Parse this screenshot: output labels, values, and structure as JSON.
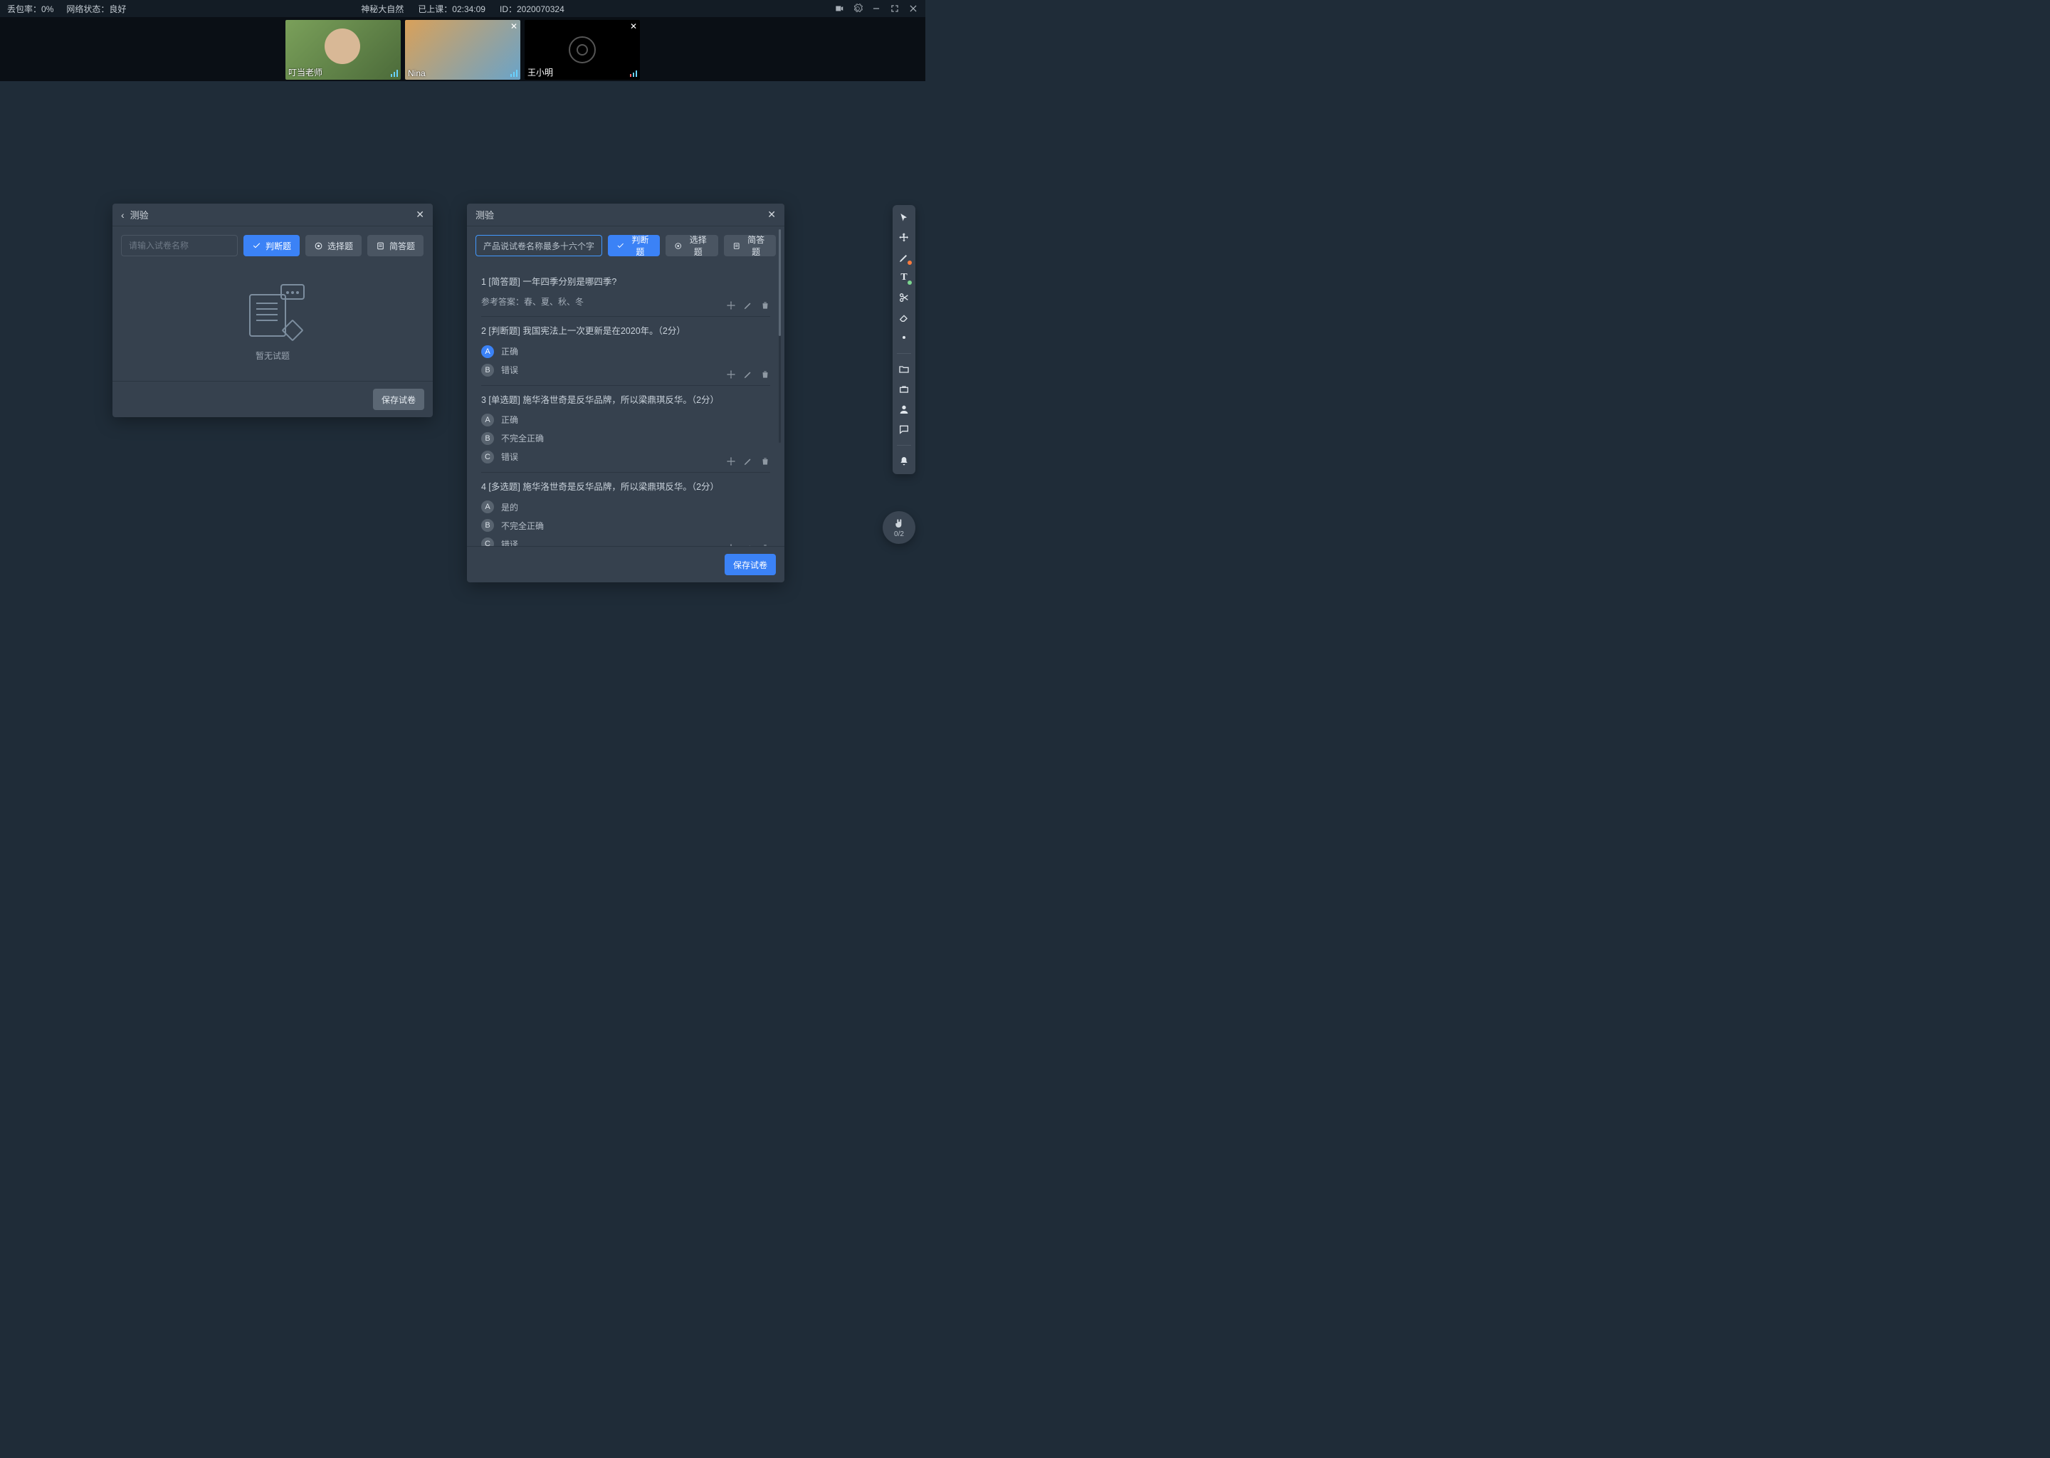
{
  "topbar": {
    "packet_loss_label": "丢包率：",
    "packet_loss_value": "0%",
    "network_label": "网络状态：",
    "network_value": "良好",
    "course_title": "神秘大自然",
    "elapsed_label": "已上课：",
    "elapsed_value": "02:34:09",
    "id_label": "ID：",
    "id_value": "2020070324"
  },
  "videos": [
    {
      "name": "叮当老师",
      "kind": "teacher",
      "closeable": false
    },
    {
      "name": "Nina",
      "kind": "student1",
      "closeable": true
    },
    {
      "name": "王小明",
      "kind": "student2",
      "closeable": true
    }
  ],
  "leftPanel": {
    "title": "测验",
    "name_placeholder": "请输入试卷名称",
    "btn_judge": "判断题",
    "btn_select": "选择题",
    "btn_short": "简答题",
    "empty_text": "暂无试题",
    "save": "保存试卷"
  },
  "rightPanel": {
    "title": "测验",
    "quiz_name": "产品说试卷名称最多十六个字",
    "btn_judge": "判断题",
    "btn_select": "选择题",
    "btn_short": "简答题",
    "save": "保存试卷",
    "questions": [
      {
        "idx": "1",
        "type": "[简答题]",
        "text": "一年四季分别是哪四季?",
        "answer_label": "参考答案：",
        "answer": "春、夏、秋、冬",
        "options": []
      },
      {
        "idx": "2",
        "type": "[判断题]",
        "text": "我国宪法上一次更新是在2020年。（2分）",
        "options": [
          {
            "k": "A",
            "v": "正确",
            "selected": true
          },
          {
            "k": "B",
            "v": "错误",
            "selected": false
          }
        ]
      },
      {
        "idx": "3",
        "type": "[单选题]",
        "text": "施华洛世奇是反华品牌，所以梁鼎琪反华。（2分）",
        "options": [
          {
            "k": "A",
            "v": "正确"
          },
          {
            "k": "B",
            "v": "不完全正确"
          },
          {
            "k": "C",
            "v": "错误"
          }
        ]
      },
      {
        "idx": "4",
        "type": "[多选题]",
        "text": "施华洛世奇是反华品牌，所以梁鼎琪反华。（2分）",
        "options": [
          {
            "k": "A",
            "v": "是的"
          },
          {
            "k": "B",
            "v": "不完全正确"
          },
          {
            "k": "C",
            "v": "错译"
          }
        ]
      }
    ]
  },
  "hand": {
    "count": "0/2"
  }
}
